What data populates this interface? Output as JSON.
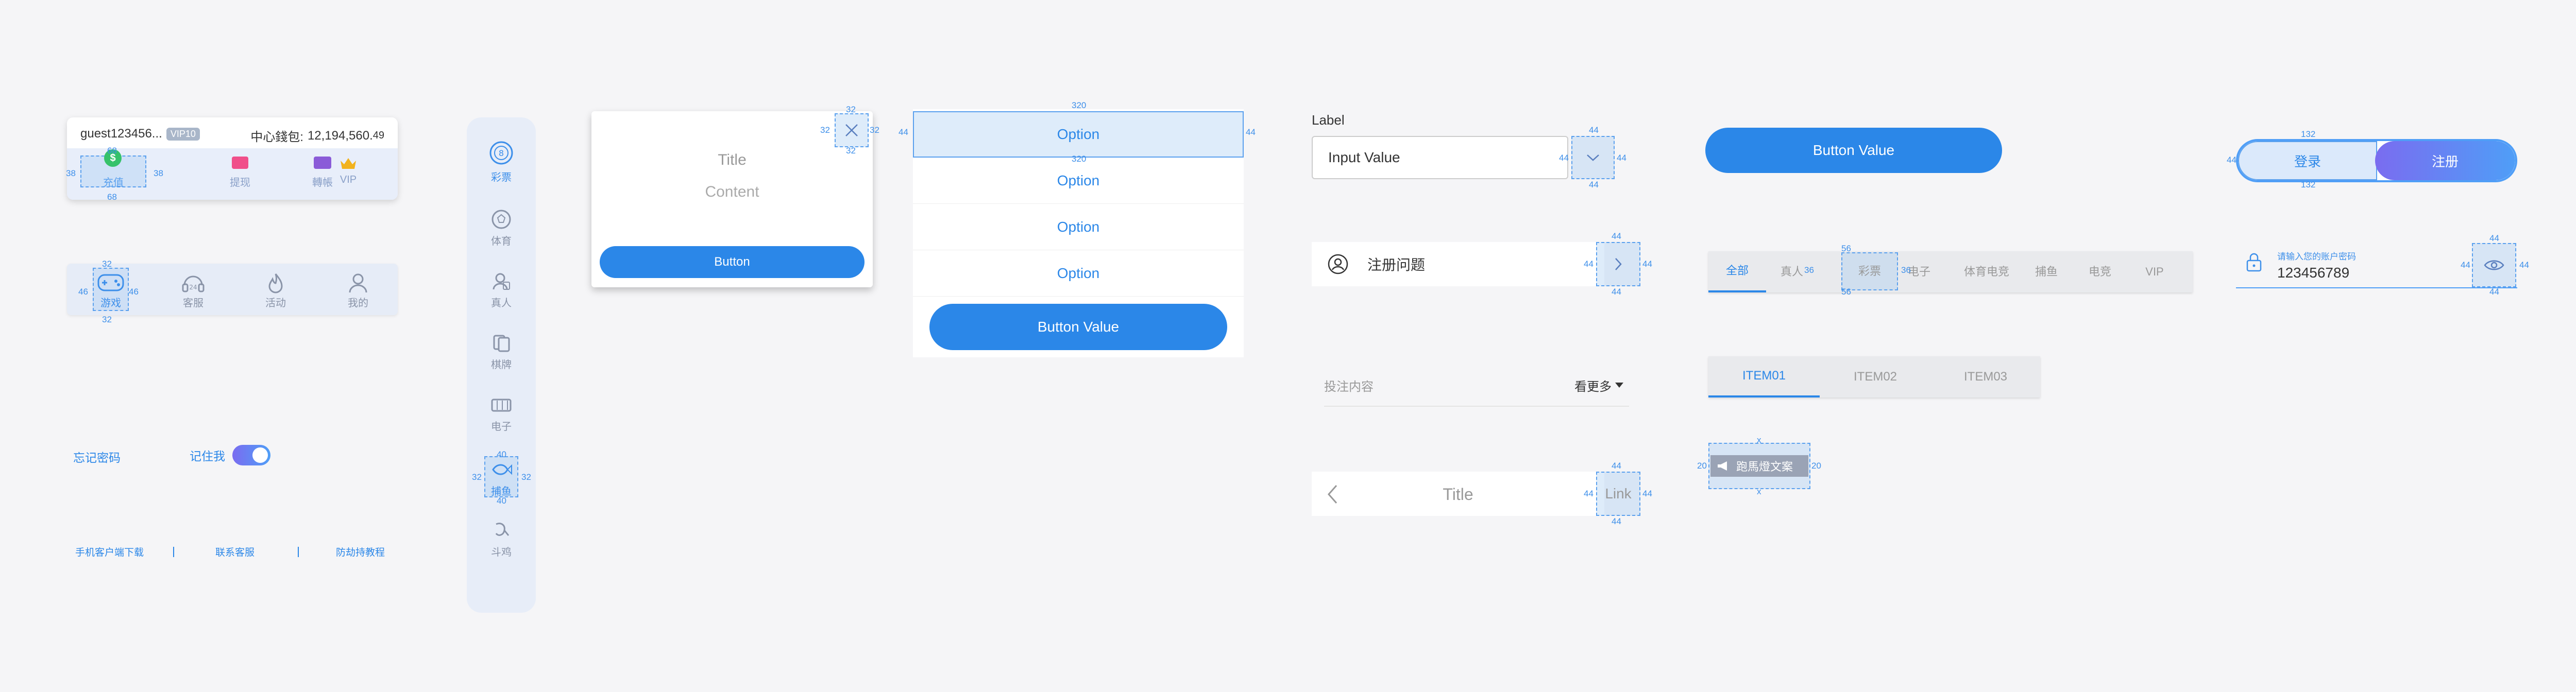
{
  "colors": {
    "primary": "#2b87e8",
    "measure": "#3d8fea",
    "gradient_start": "#7a6cf0",
    "gradient_end": "#4f9ef7"
  },
  "user_card": {
    "username": "guest123456...",
    "vip_badge": "VIP10",
    "wallet_label": "中心錢包:",
    "wallet_amount": "12,194,560.",
    "wallet_cents": "49",
    "actions": [
      {
        "label": "充值",
        "icon": "dollar-coin-icon"
      },
      {
        "label": "提现",
        "icon": "withdraw-card-icon"
      },
      {
        "label": "轉帳",
        "icon": "transfer-card-icon"
      },
      {
        "label": "VIP",
        "icon": "crown-icon"
      }
    ],
    "dims": {
      "top": "68",
      "bottom": "68",
      "left": "38",
      "right": "38"
    }
  },
  "bottom_nav": {
    "items": [
      {
        "label": "游戏",
        "icon": "gamepad-icon"
      },
      {
        "label": "客服",
        "icon": "headset-icon"
      },
      {
        "label": "活动",
        "icon": "flame-icon"
      },
      {
        "label": "我的",
        "icon": "person-icon"
      }
    ],
    "dims": {
      "top": "32",
      "bottom": "32",
      "left": "46",
      "right": "46"
    }
  },
  "login_options": {
    "forgot_password": "忘记密码",
    "remember_me": "记住我",
    "remember_on": true
  },
  "footer_links": [
    "手机客户端下载",
    "联系客服",
    "防劫持教程"
  ],
  "side_nav": {
    "items": [
      {
        "label": "彩票",
        "icon": "lottery-ball-icon"
      },
      {
        "label": "体育",
        "icon": "soccer-ball-icon"
      },
      {
        "label": "真人",
        "icon": "live-dealer-icon"
      },
      {
        "label": "棋牌",
        "icon": "cards-icon"
      },
      {
        "label": "电子",
        "icon": "slot-machine-icon"
      },
      {
        "label": "捕鱼",
        "icon": "fish-icon"
      },
      {
        "label": "斗鸡",
        "icon": "rooster-icon"
      }
    ],
    "dims": {
      "top": "40",
      "bottom": "40",
      "left": "32",
      "right": "32"
    }
  },
  "modal": {
    "title": "Title",
    "content": "Content",
    "button": "Button",
    "dims": {
      "top": "32",
      "bottom": "32",
      "left": "32",
      "right": "32"
    }
  },
  "action_sheet": {
    "options": [
      "Option",
      "Option",
      "Option",
      "Option"
    ],
    "button": "Button Value",
    "dims": {
      "top": "320",
      "bottom": "320",
      "left": "44",
      "right": "44"
    }
  },
  "input_select": {
    "label": "Label",
    "value": "Input Value",
    "dims": {
      "top": "44",
      "bottom": "44",
      "left": "44",
      "right": "44"
    }
  },
  "list_cell": {
    "text": "注册问题",
    "dims": {
      "top": "44",
      "bottom": "44",
      "left": "44",
      "right": "44"
    }
  },
  "bet_row": {
    "text": "投注内容",
    "more": "看更多"
  },
  "nav_bar": {
    "title": "Title",
    "link": "Link",
    "dims": {
      "top": "44",
      "bottom": "44",
      "left": "44",
      "right": "44"
    }
  },
  "primary_button": {
    "label": "Button Value"
  },
  "game_tabs": {
    "items": [
      "全部",
      "真人",
      "彩票",
      "电子",
      "体育电竞",
      "捕鱼",
      "电竞",
      "VIP"
    ],
    "dims": {
      "top": "56",
      "bottom": "56",
      "left": "36",
      "right": "36"
    }
  },
  "item_tabs": {
    "items": [
      "ITEM01",
      "ITEM02",
      "ITEM03"
    ]
  },
  "marquee": {
    "text": "跑馬燈文案",
    "dims": {
      "top": "x",
      "bottom": "x",
      "left": "20",
      "right": "20"
    }
  },
  "auth_toggle": {
    "login": "登录",
    "register": "注册",
    "dims": {
      "top": "132",
      "bottom": "132",
      "left": "44"
    }
  },
  "password_field": {
    "label": "请输入您的账户密码",
    "value": "123456789",
    "dims": {
      "top": "44",
      "bottom": "44",
      "left": "44",
      "right": "44"
    }
  }
}
